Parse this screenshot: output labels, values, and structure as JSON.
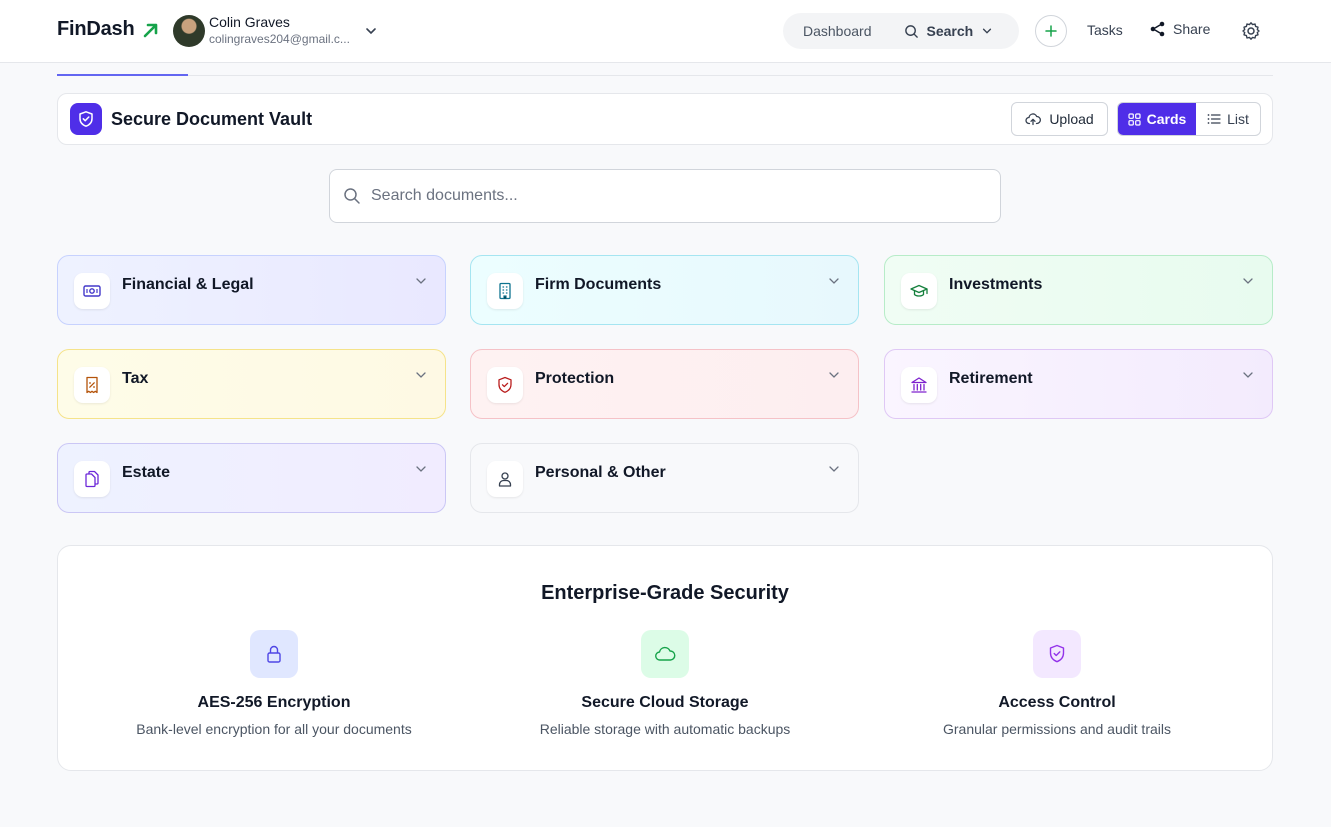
{
  "header": {
    "brand": "FinDash",
    "user_name": "Colin Graves",
    "user_email": "colingraves204@gmail.c...",
    "nav_dashboard": "Dashboard",
    "nav_search": "Search",
    "tasks": "Tasks",
    "share": "Share"
  },
  "vault": {
    "title": "Secure Document Vault",
    "upload": "Upload",
    "view_cards": "Cards",
    "view_list": "List",
    "active_view": "Cards"
  },
  "search": {
    "placeholder": "Search documents..."
  },
  "categories": [
    {
      "label": "Financial & Legal",
      "icon": "banknote-icon",
      "color": "#4338ca"
    },
    {
      "label": "Firm Documents",
      "icon": "building-icon",
      "color": "#0e7490"
    },
    {
      "label": "Investments",
      "icon": "graduation-cap-icon",
      "color": "#15803d"
    },
    {
      "label": "Tax",
      "icon": "receipt-icon",
      "color": "#b45309"
    },
    {
      "label": "Protection",
      "icon": "shield-check-icon",
      "color": "#b91c1c"
    },
    {
      "label": "Retirement",
      "icon": "landmark-icon",
      "color": "#7e22ce"
    },
    {
      "label": "Estate",
      "icon": "files-icon",
      "color": "#6d28d9"
    },
    {
      "label": "Personal & Other",
      "icon": "user-icon",
      "color": "#374151"
    }
  ],
  "security": {
    "title": "Enterprise-Grade Security",
    "features": [
      {
        "title": "AES-256 Encryption",
        "desc": "Bank-level encryption for all your documents",
        "icon": "lock-icon",
        "color": "#4f46e5",
        "bg": "#e0e7ff"
      },
      {
        "title": "Secure Cloud Storage",
        "desc": "Reliable storage with automatic backups",
        "icon": "cloud-icon",
        "color": "#16a34a",
        "bg": "#dcfce7"
      },
      {
        "title": "Access Control",
        "desc": "Granular permissions and audit trails",
        "icon": "shield-check-icon",
        "color": "#9333ea",
        "bg": "#f3e8ff"
      }
    ]
  },
  "colors": {
    "accent": "#4f2ee8",
    "brand_arrow": "#16a34a"
  }
}
